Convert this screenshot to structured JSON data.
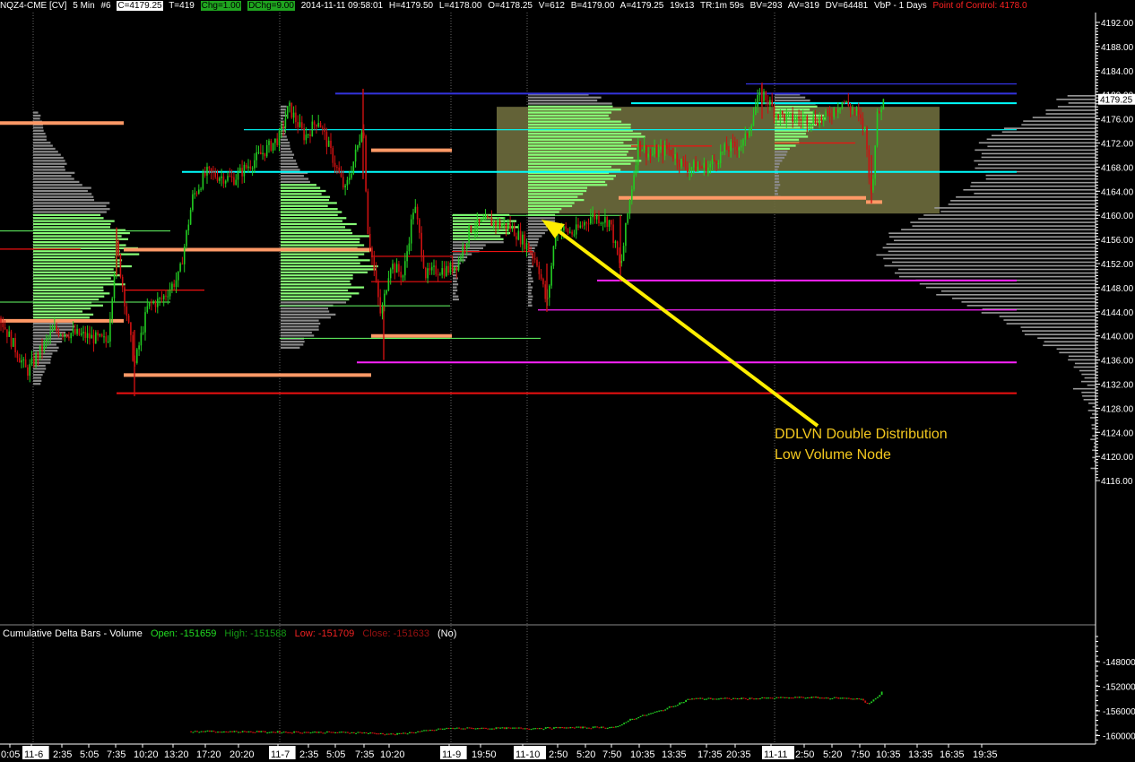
{
  "header": {
    "symbol": "NQZ4-CME [CV]",
    "interval": "5 Min",
    "bar_no": "#6",
    "close": "C=4179.25",
    "ticks": "T=419",
    "chg": "Chg=1.00",
    "dchg": "DChg=9.00",
    "datetime": "2014-11-11 09:58:01",
    "high": "H=4179.50",
    "low": "L=4178.00",
    "open": "O=4178.25",
    "volume": "V=612",
    "bid": "B=4179.00",
    "ask": "A=4179.25",
    "size": "19x13",
    "timer": "TR:1m 59s",
    "bv": "BV=293",
    "av": "AV=319",
    "dv": "DV=64481",
    "vbp": "VbP - 1 Days",
    "poc": "Point of Control: 4178.0"
  },
  "delta_header": {
    "title": "Cumulative Delta Bars - Volume",
    "open": "Open: -151659",
    "high": "High: -151588",
    "low": "Low: -151709",
    "close": "Close: -151633",
    "flag": "(No)"
  },
  "price_axis": {
    "ticks": [
      "4192.00",
      "4188.00",
      "4184.00",
      "4180.00",
      "4176.00",
      "4172.00",
      "4168.00",
      "4164.00",
      "4160.00",
      "4156.00",
      "4152.00",
      "4148.00",
      "4144.00",
      "4140.00",
      "4136.00",
      "4132.00",
      "4128.00",
      "4124.00",
      "4120.00",
      "4116.00"
    ],
    "last_price": "4179.25"
  },
  "delta_axis": {
    "ticks": [
      "-148000",
      "-152000",
      "-156000",
      "-160000"
    ]
  },
  "time_axis": {
    "labels": [
      {
        "t": "0:05",
        "date": false
      },
      {
        "t": "11-6",
        "date": true
      },
      {
        "t": "2:35",
        "date": false
      },
      {
        "t": "5:05",
        "date": false
      },
      {
        "t": "7:35",
        "date": false
      },
      {
        "t": "10:20",
        "date": false
      },
      {
        "t": "13:20",
        "date": false
      },
      {
        "t": "17:20",
        "date": false
      },
      {
        "t": "20:20",
        "date": false
      },
      {
        "t": "11-7",
        "date": true
      },
      {
        "t": "2:35",
        "date": false
      },
      {
        "t": "5:05",
        "date": false
      },
      {
        "t": "7:35",
        "date": false
      },
      {
        "t": "10:20",
        "date": false
      },
      {
        "t": "11-9",
        "date": true
      },
      {
        "t": "19:50",
        "date": false
      },
      {
        "t": "11-10",
        "date": true
      },
      {
        "t": "2:50",
        "date": false
      },
      {
        "t": "5:20",
        "date": false
      },
      {
        "t": "7:50",
        "date": false
      },
      {
        "t": "10:35",
        "date": false
      },
      {
        "t": "13:35",
        "date": false
      },
      {
        "t": "17:35",
        "date": false
      },
      {
        "t": "20:35",
        "date": false
      },
      {
        "t": "11-11",
        "date": true
      },
      {
        "t": "2:50",
        "date": false
      },
      {
        "t": "5:20",
        "date": false
      },
      {
        "t": "7:50",
        "date": false
      },
      {
        "t": "10:35",
        "date": false
      },
      {
        "t": "13:35",
        "date": false
      },
      {
        "t": "16:35",
        "date": false
      },
      {
        "t": "19:35",
        "date": false
      }
    ]
  },
  "annotation": {
    "line1": "DDLVN Double Distribution",
    "line2": "Low Volume Node"
  },
  "colors": {
    "up": "#22cc22",
    "down": "#cc1111",
    "profile": "#88ff77",
    "profile_gray": "#8a8a8a",
    "poc_line": "#ff9966",
    "value_line": "#00ffff",
    "high_line": "#3333dd",
    "magenta_line": "#ff22ff",
    "red_line": "#ee1111",
    "box": "#6b6a3c",
    "arrow": "#ffee00",
    "ann_text": "#f3c81f",
    "chg_bg": "#1fa51f",
    "poc_text": "#ff2222"
  }
}
